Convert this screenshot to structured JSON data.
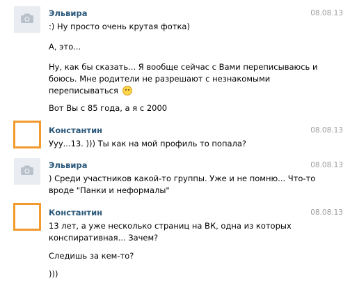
{
  "messages": [
    {
      "author": "Эльвира",
      "date": "08.08.13",
      "avatar": "camera-icon",
      "lines": [
        ":) Ну просто очень крутая фотка)",
        "А, это...",
        "Ну, как бы сказать... Я вообще сейчас с Вами переписываюсь и",
        "боюсь. Мне родители не разрешают с незнакомыми",
        "переписываться",
        "Вот Вы с 85 года, а я с 2000"
      ]
    },
    {
      "author": "Константин",
      "date": "08.08.13",
      "avatar": "orange-frame",
      "lines": [
        "Ууу...13. ))) Ты как на мой профиль то попала?"
      ]
    },
    {
      "author": "Эльвира",
      "date": "08.08.13",
      "avatar": "camera-icon",
      "lines": [
        ") Среди участников какой-то группы. Уже и не помню... Что-то",
        "вроде \"Панки и неформалы\""
      ]
    },
    {
      "author": "Константин",
      "date": "08.08.13",
      "avatar": "orange-frame",
      "lines": [
        "13 лет, а уже несколько страниц на ВК, одна из которых",
        "конспиративная... Зачем?",
        "Следишь за кем-то?",
        ")))"
      ]
    }
  ],
  "colors": {
    "author_name": "#2b587a",
    "date": "#9b9b9b",
    "avatar_frame": "#f29a2e",
    "avatar_bg": "#e9ecf0"
  }
}
